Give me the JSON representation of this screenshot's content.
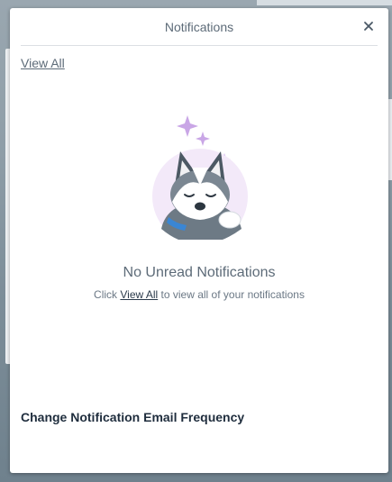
{
  "panel": {
    "title": "Notifications",
    "close_icon": "close-icon",
    "view_all_link": "View All"
  },
  "empty_state": {
    "illustration": "sleeping-husky-illustration",
    "sparkle_color": "#c9a6e6",
    "title": "No Unread Notifications",
    "subtitle_prefix": "Click ",
    "subtitle_link": "View All",
    "subtitle_suffix": " to view all of your notifications"
  },
  "footer": {
    "email_frequency_link": "Change Notification Email Frequency"
  },
  "colors": {
    "text_muted": "#5d6b78",
    "text_dark": "#1f2d3d",
    "divider": "#dcdfe3"
  }
}
